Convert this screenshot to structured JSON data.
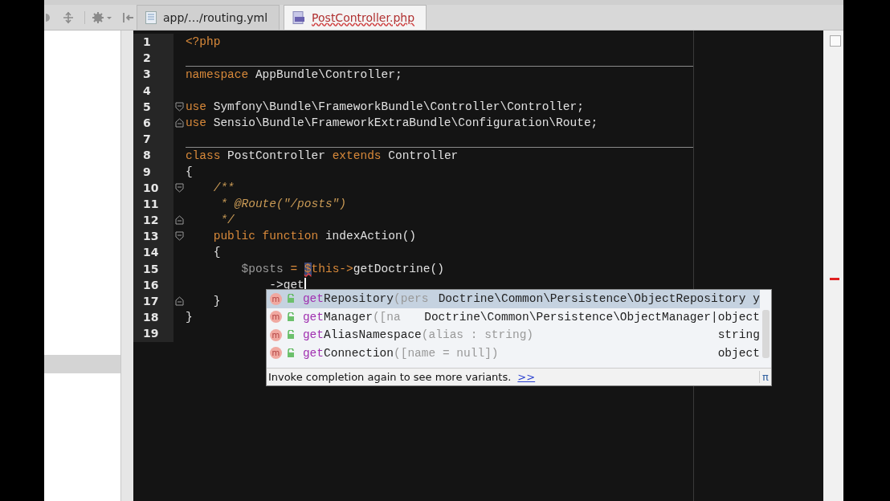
{
  "tabs": [
    {
      "label": "app/…/routing.yml",
      "selected": false
    },
    {
      "label": "PostController.php",
      "selected": true
    }
  ],
  "sidebar": {
    "rows": [
      {
        "selected": true
      }
    ]
  },
  "editor": {
    "lines": [
      {
        "number": "1",
        "tokens": [
          {
            "text": "<?php",
            "kind": "keyword"
          }
        ]
      },
      {
        "number": "2"
      },
      {
        "number": "3",
        "separator": true,
        "tokens": [
          {
            "text": "namespace",
            "kind": "keyword"
          },
          {
            "text": " AppBundle\\Controller;",
            "kind": "plain"
          }
        ]
      },
      {
        "number": "4"
      },
      {
        "number": "5",
        "fold_start": true,
        "tokens": [
          {
            "text": "use",
            "kind": "keyword"
          },
          {
            "text": " Symfony\\Bundle\\FrameworkBundle\\Controller\\Controller;",
            "kind": "plain"
          }
        ]
      },
      {
        "number": "6",
        "fold_end": true,
        "tokens": [
          {
            "text": "use",
            "kind": "keyword"
          },
          {
            "text": " Sensio\\Bundle\\FrameworkExtraBundle\\Configuration\\Route;",
            "kind": "plain"
          }
        ]
      },
      {
        "number": "7"
      },
      {
        "number": "8",
        "separator": true,
        "tokens": [
          {
            "text": "class",
            "kind": "keyword"
          },
          {
            "text": " PostController ",
            "kind": "plain"
          },
          {
            "text": "extends",
            "kind": "keyword"
          },
          {
            "text": " Controller",
            "kind": "plain"
          }
        ]
      },
      {
        "number": "9",
        "tokens": [
          {
            "text": "{",
            "kind": "plain"
          }
        ]
      },
      {
        "number": "10",
        "fold_start": true,
        "tokens": [
          {
            "text": "    /**",
            "kind": "comment"
          }
        ]
      },
      {
        "number": "11",
        "tokens": [
          {
            "text": "     * @Route(\"/posts\")",
            "kind": "comment"
          }
        ]
      },
      {
        "number": "12",
        "fold_end": true,
        "tokens": [
          {
            "text": "     */",
            "kind": "comment"
          }
        ]
      },
      {
        "number": "13",
        "fold_start": true,
        "tokens": [
          {
            "text": "    public function",
            "kind": "keyword"
          },
          {
            "text": " indexAction()",
            "kind": "plain"
          }
        ]
      },
      {
        "number": "14",
        "tokens": [
          {
            "text": "    {",
            "kind": "plain"
          }
        ]
      },
      {
        "number": "15",
        "tokens": [
          {
            "text": "        $posts",
            "kind": "var"
          },
          {
            "text": " = ",
            "kind": "keyword"
          },
          {
            "text": "$",
            "kind": "keyword",
            "highlight": true,
            "error": true
          },
          {
            "text": "this->",
            "kind": "keyword"
          },
          {
            "text": "getDoctrine()",
            "kind": "plain"
          }
        ]
      },
      {
        "number": "16",
        "caret": true,
        "tokens": [
          {
            "text": "            ->get",
            "kind": "plain"
          }
        ]
      },
      {
        "number": "17",
        "fold_end": true,
        "tokens": [
          {
            "text": "    }",
            "kind": "plain"
          }
        ]
      },
      {
        "number": "18",
        "tokens": [
          {
            "text": "}",
            "kind": "plain"
          }
        ]
      },
      {
        "number": "19"
      }
    ]
  },
  "completion": {
    "items": [
      {
        "badge": "m",
        "prefix": "get",
        "name": "Repository",
        "params": "(pers",
        "type": "Doctrine\\Common\\Persistence\\ObjectRepository y",
        "selected": true
      },
      {
        "badge": "m",
        "prefix": "get",
        "name": "Manager",
        "params": "([na",
        "type": "Doctrine\\Common\\Persistence\\ObjectManager|object",
        "selected": false
      },
      {
        "badge": "m",
        "prefix": "get",
        "name": "AliasNamespace",
        "params": "(alias : string)",
        "type": "string",
        "selected": false
      },
      {
        "badge": "m",
        "prefix": "get",
        "name": "Connection",
        "params": "([name = null])",
        "type": "object",
        "selected": false
      }
    ],
    "hint": "Invoke completion again to see more variants.",
    "link": ">>",
    "corner": "π"
  }
}
